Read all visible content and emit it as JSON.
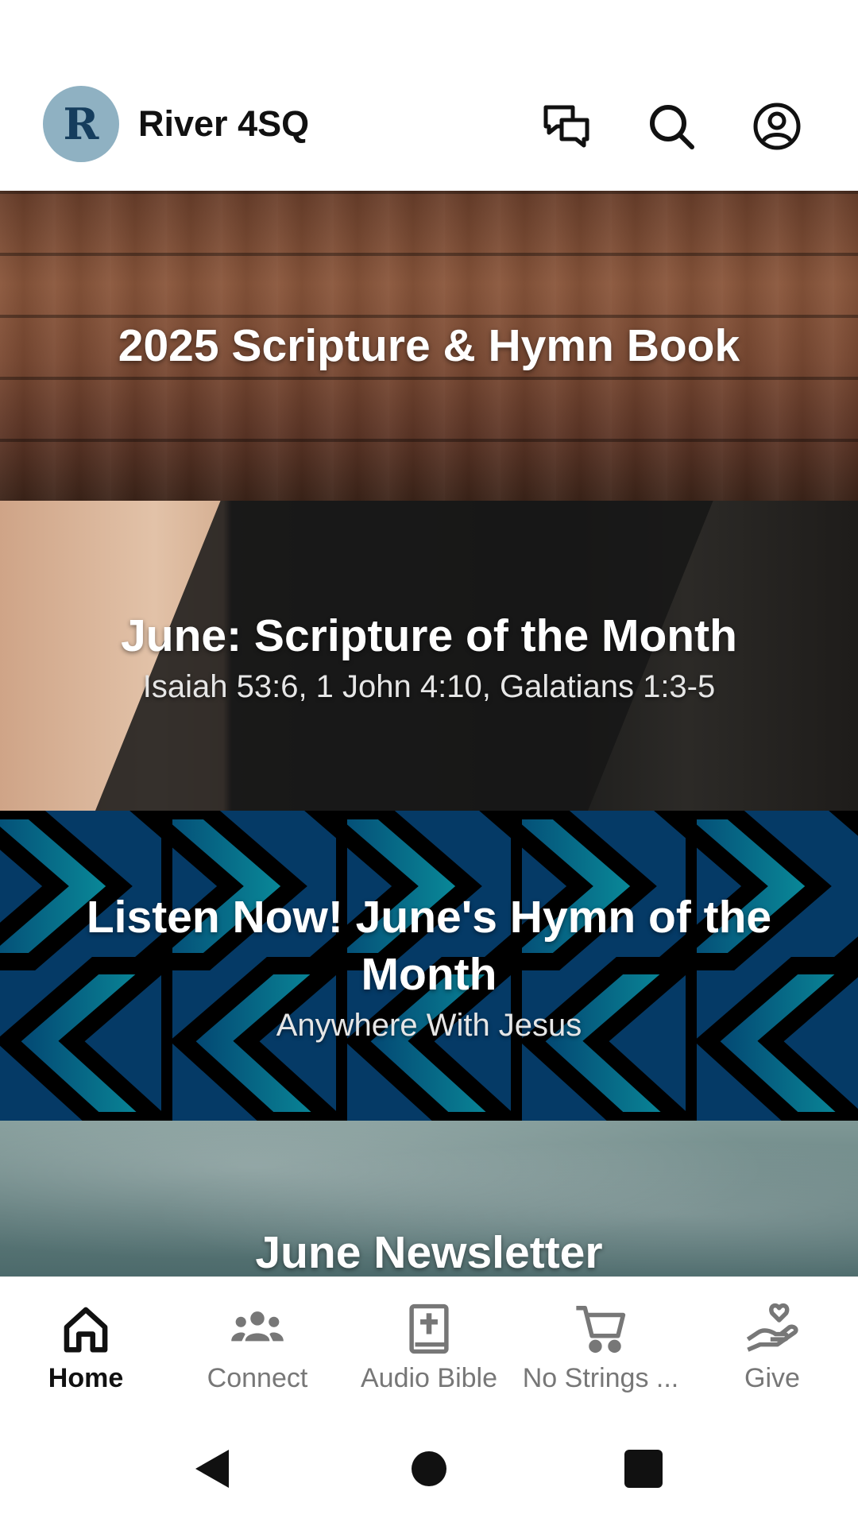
{
  "header": {
    "logo_letter": "R",
    "title": "River 4SQ",
    "icons": [
      "chat-icon",
      "search-icon",
      "account-icon"
    ]
  },
  "cards": [
    {
      "title": "2025 Scripture & Hymn Book",
      "subtitle": ""
    },
    {
      "title": "June: Scripture of the Month",
      "subtitle": "Isaiah 53:6, 1 John 4:10, Galatians 1:3-5"
    },
    {
      "title": "Listen Now!  June's Hymn of the Month",
      "subtitle": "Anywhere With Jesus"
    },
    {
      "title": "June Newsletter",
      "subtitle": ""
    }
  ],
  "bottom_nav": [
    {
      "label": "Home",
      "icon": "home-icon",
      "active": true
    },
    {
      "label": "Connect",
      "icon": "people-icon",
      "active": false
    },
    {
      "label": "Audio Bible",
      "icon": "bible-icon",
      "active": false
    },
    {
      "label": "No Strings ...",
      "icon": "cart-icon",
      "active": false
    },
    {
      "label": "Give",
      "icon": "give-icon",
      "active": false
    }
  ],
  "colors": {
    "logo_bg": "#8fb1c2",
    "logo_letter": "#153d5d",
    "nav_active": "#111111",
    "nav_inactive": "#777777"
  }
}
